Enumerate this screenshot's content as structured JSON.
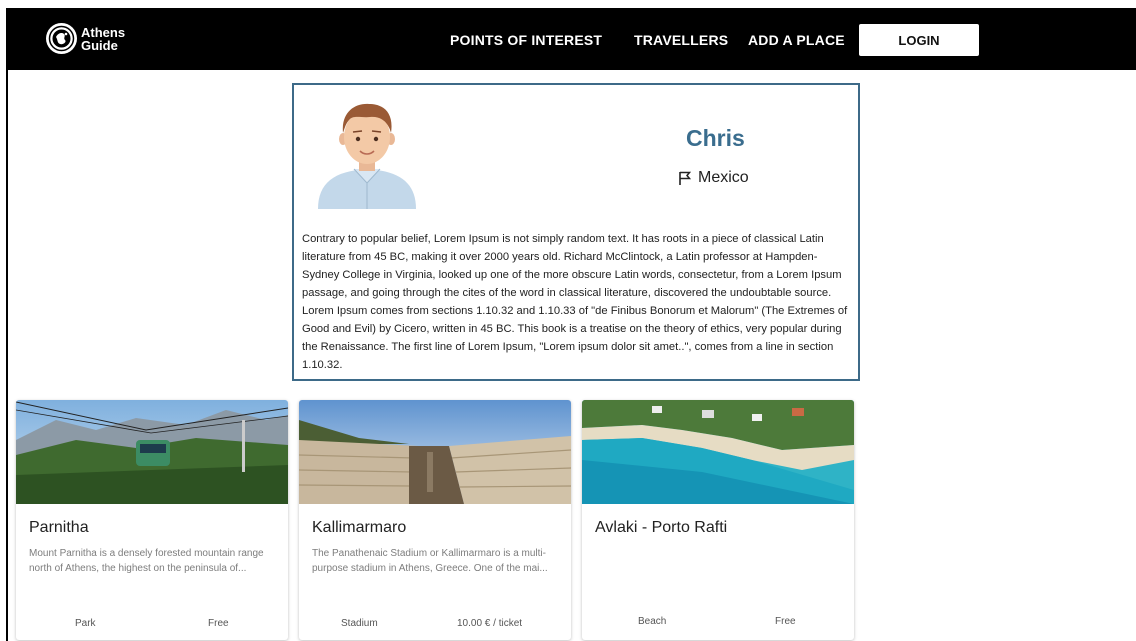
{
  "brand": {
    "line1": "Athens",
    "line2": "Guide",
    "logo_icon": "globe-logo-icon"
  },
  "nav": {
    "points_of_interest": "POINTS OF INTEREST",
    "travellers": "TRAVELLERS",
    "add_place": "ADD A PLACE",
    "login": "LOGIN"
  },
  "profile": {
    "name": "Chris",
    "country": "Mexico",
    "country_icon": "flag-icon",
    "bio": "Contrary to popular belief, Lorem Ipsum is not simply random text. It has roots in a piece of classical Latin literature from 45 BC, making it over 2000 years old. Richard McClintock, a Latin professor at Hampden-Sydney College in Virginia, looked up one of the more obscure Latin words, consectetur, from a Lorem Ipsum passage, and going through the cites of the word in classical literature, discovered the undoubtable source. Lorem Ipsum comes from sections 1.10.32 and 1.10.33 of \"de Finibus Bonorum et Malorum\" (The Extremes of Good and Evil) by Cicero, written in 45 BC. This book is a treatise on the theory of ethics, very popular during the Renaissance. The first line of Lorem Ipsum, \"Lorem ipsum dolor sit amet..\", comes from a line in section 1.10.32."
  },
  "places": [
    {
      "title": "Parnitha",
      "description": "Mount Parnitha is a densely forested mountain range north of Athens, the highest on the peninsula of...",
      "category": "Park",
      "price": "Free"
    },
    {
      "title": "Kallimarmaro",
      "description": "The Panathenaic Stadium or Kallimarmaro is a multi-purpose stadium in Athens, Greece. One of the mai...",
      "category": "Stadium",
      "price": "10.00 € / ticket"
    },
    {
      "title": "Avlaki - Porto Rafti",
      "description": "",
      "category": "Beach",
      "price": "Free"
    }
  ],
  "colors": {
    "navbar": "#000000",
    "accent": "#3a6d8e",
    "card_border": "#3d6a88"
  }
}
